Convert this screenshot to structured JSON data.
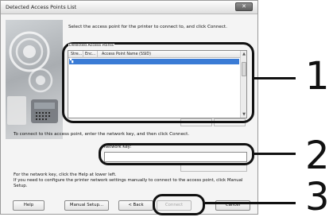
{
  "window": {
    "title": "Detected Access Points List",
    "close_glyph": "✕"
  },
  "instruction": "Select the access point for the printer to connect to, and click Connect.",
  "access_points": {
    "group_label": "Detected Access Points",
    "columns": [
      "Stre...",
      "Enc...",
      "Access Point Name (SSID)"
    ],
    "rows": [
      {
        "strength_icon": "signal-strength-icon",
        "strength_glyph": "▚",
        "encryption": "",
        "ssid": ""
      }
    ],
    "scroll_up_glyph": "▲",
    "scroll_down_glyph": "▼"
  },
  "network_key": {
    "instruction": "To connect to this access point, enter the network key, and then click Connect.",
    "label": "Network Key:",
    "value": ""
  },
  "help_note": {
    "line1": "For the network key, click the Help at lower left.",
    "line2": "If you need to configure the printer network settings manually to connect to the access point, click Manual Setup."
  },
  "buttons": {
    "help": "Help",
    "manual_setup": "Manual Setup...",
    "back": "< Back",
    "connect": "Connect",
    "cancel": "Cancel"
  },
  "callouts": [
    "1",
    "2",
    "3"
  ],
  "colors": {
    "selection": "#3a7bd5",
    "callout": "#111111"
  }
}
